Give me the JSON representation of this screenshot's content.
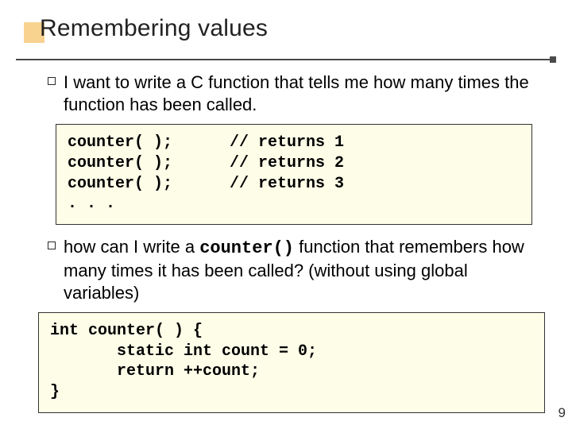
{
  "title": "Remembering values",
  "bullets": {
    "b1": "I want to write a C function that tells me how many times the function has been called.",
    "b2_pre": "how can I write a ",
    "b2_code": "counter()",
    "b2_post": " function that remembers how many times it has been called? (without using global variables)"
  },
  "code1": "counter( );      // returns 1\ncounter( );      // returns 2\ncounter( );      // returns 3\n. . .",
  "code2": "int counter( ) {\n       static int count = 0;\n       return ++count;\n}",
  "page_number": "9"
}
